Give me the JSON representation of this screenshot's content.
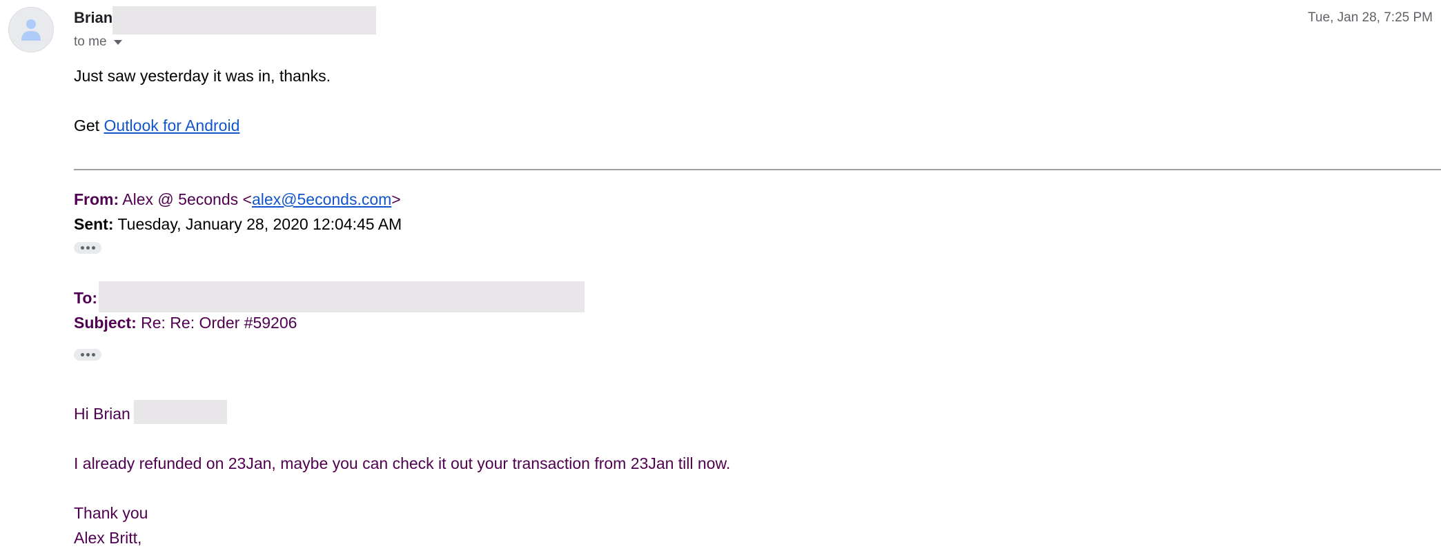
{
  "message": {
    "sender_name": "Brian",
    "recipient_label": "to me",
    "date": "Tue, Jan 28, 7:25 PM",
    "reply_line": "Just saw yesterday it was in, thanks.",
    "signature_prefix": "Get",
    "signature_link": "Outlook for Android"
  },
  "quoted": {
    "from_label": "From:",
    "from_name": "Alex @ 5econds <",
    "from_email": "alex@5econds.com",
    "from_close": ">",
    "sent_label": "Sent:",
    "sent_value": "Tuesday, January 28, 2020 12:04:45 AM",
    "to_label": "To:",
    "subject_label": "Subject:",
    "subject_value": "Re: Re: Order #59206",
    "greeting": "Hi Brian",
    "body_line": "I already refunded on 23Jan, maybe you can check it out your transaction from 23Jan till now.",
    "closing": "Thank you",
    "signer": "Alex Britt,"
  },
  "icons": {
    "avatar": "person-icon",
    "recipient_menu": "caret-down-icon",
    "expand": "ellipsis-icon"
  },
  "colors": {
    "link": "#1155cc",
    "quoted_text": "#500050",
    "secondary_text": "#5f6368",
    "redaction": "#e8e6e8"
  }
}
